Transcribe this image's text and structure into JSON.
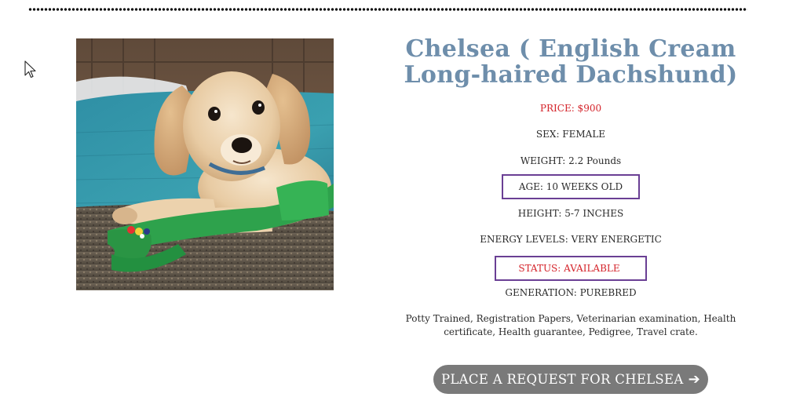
{
  "listing": {
    "title": "Chelsea ( English Cream Long-haired Dachshund)",
    "price": "PRICE: $900",
    "sex": "SEX: FEMALE",
    "weight": "WEIGHT: 2.2 Pounds",
    "age": "AGE: 10 WEEKS OLD",
    "height": "HEIGHT: 5-7 INCHES",
    "energy": "ENERGY LEVELS: VERY ENERGETIC",
    "status": "STATUS: AVAILABLE",
    "generation": "GENERATION: PUREBRED",
    "features": "Potty Trained, Registration Papers, Veterinarian examination, Health certificate, Health guarantee, Pedigree, Travel crate."
  },
  "cta": {
    "label": "PLACE A REQUEST FOR CHELSEA",
    "icon": "arrow-right-icon",
    "arrow_glyph": "➔"
  },
  "photo": {
    "subject": "puppy-photo"
  },
  "colors": {
    "title": "#6e8eab",
    "accent_red": "#d4232a",
    "highlight_box": "#6a3f94",
    "button": "#7a7a7a"
  }
}
